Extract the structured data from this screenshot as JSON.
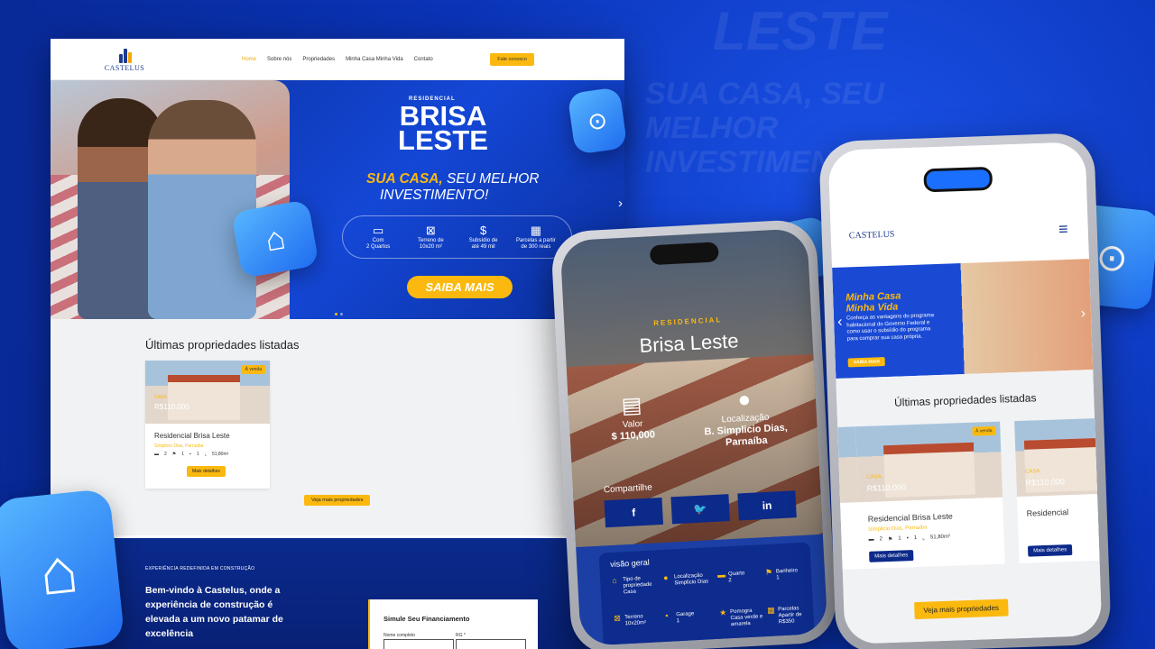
{
  "watermark": {
    "word": "LESTE",
    "tagline": "SUA CASA, SEU MELHOR INVESTIMENTO!"
  },
  "site": {
    "brand": "CASTELUS",
    "nav": [
      "Home",
      "Sobre nós",
      "Propriedades",
      "Minha Casa Minha Vida",
      "Contato"
    ],
    "cta": "Fale conosco"
  },
  "hero": {
    "residencial": "RESIDENCIAL",
    "name_line1": "BRISA",
    "name_line2": "LESTE",
    "tag_highlight": "SUA CASA,",
    "tag_rest": " SEU MELHOR",
    "tag_line2": "INVESTIMENTO!",
    "features": [
      {
        "icon": "bed-icon",
        "glyph": "🛏",
        "line1": "Com",
        "line2": "2 Quartos"
      },
      {
        "icon": "land-icon",
        "glyph": "⊠",
        "line1": "Terreno de",
        "line2": "10x20 m²"
      },
      {
        "icon": "subsidy-icon",
        "glyph": "$",
        "line1": "Subsídio de",
        "line2": "até 49 mil"
      },
      {
        "icon": "calendar-icon",
        "glyph": "▦",
        "line1": "Parcelas a partir",
        "line2": "de 300 reais"
      }
    ],
    "button": "SAIBA MAIS"
  },
  "listing": {
    "heading": "Últimas propriedades listadas",
    "card": {
      "badge": "À venda",
      "type": "CASA",
      "price": "R$110,000",
      "title": "Residencial Brisa Leste",
      "location": "Simplicio Dias, Parnaíba",
      "beds": "2",
      "baths": "1",
      "garage": "1",
      "area": "51,80m²",
      "button": "Mais detalhes"
    },
    "more_button": "Veja mais propriedades"
  },
  "about": {
    "eyebrow": "EXPERIÊNCIA REDEFINIDA EM CONSTRUÇÃO",
    "headline": "Bem-vindo à Castelus, onde a experiência de construção é elevada a um novo patamar de excelência",
    "sim_title": "Simule Seu Financiamento",
    "sim_label1": "Nome completo",
    "sim_label2": "RG *"
  },
  "phone1": {
    "residencial": "RESIDENCIAL",
    "title": "Brisa Leste",
    "valor_label": "Valor",
    "valor": "$ 110,000",
    "loc_label": "Localização",
    "loc_line1": "B. Simplicio Dias,",
    "loc_line2": "Parnaíba",
    "share": "Compartilhe",
    "share_fb": "f",
    "share_tw": "🐦",
    "share_in": "in",
    "overview": "visão geral",
    "items": [
      {
        "label": "Tipo de propriedade",
        "value": "Casa"
      },
      {
        "label": "Localização",
        "value": "Simplicio Dias"
      },
      {
        "label": "Quarto",
        "value": "2"
      },
      {
        "label": "Banheiro",
        "value": "1"
      },
      {
        "label": "Terreno",
        "value": "10x20m²"
      },
      {
        "label": "Garage",
        "value": "1"
      },
      {
        "label": "Pomogra",
        "value": "Casa verde e amarela"
      },
      {
        "label": "Parcelas",
        "value": "Apartir de R$350"
      }
    ]
  },
  "phone2": {
    "brand": "CASTELUS",
    "banner_title1": "Minha Casa",
    "banner_title2": "Minha Vida",
    "banner_text": "Conheça as vantagens do programa habitacional do Governo Federal e como usar o subsídio do programa para comprar sua casa própria.",
    "banner_button": "SAIBA MAIS",
    "heading": "Últimas propriedades listadas",
    "card_badge": "À venda",
    "card_type": "CASA",
    "card_price": "R$110,000",
    "card_title": "Residencial Brisa Leste",
    "card_location": "Simplicio Dias, Parnaíba",
    "card_beds": "2",
    "card_baths": "1",
    "card_garage": "1",
    "card_area": "51,80m²",
    "card_button": "Mais detalhes",
    "card2_type": "CASA",
    "card2_price": "R$110,000",
    "card2_title": "Residencial",
    "card2_button": "Mais detalhes",
    "more_button": "Veja mais propriedades"
  },
  "colors": {
    "brand_blue": "#0c2a8a",
    "accent_yellow": "#fbb90f"
  }
}
